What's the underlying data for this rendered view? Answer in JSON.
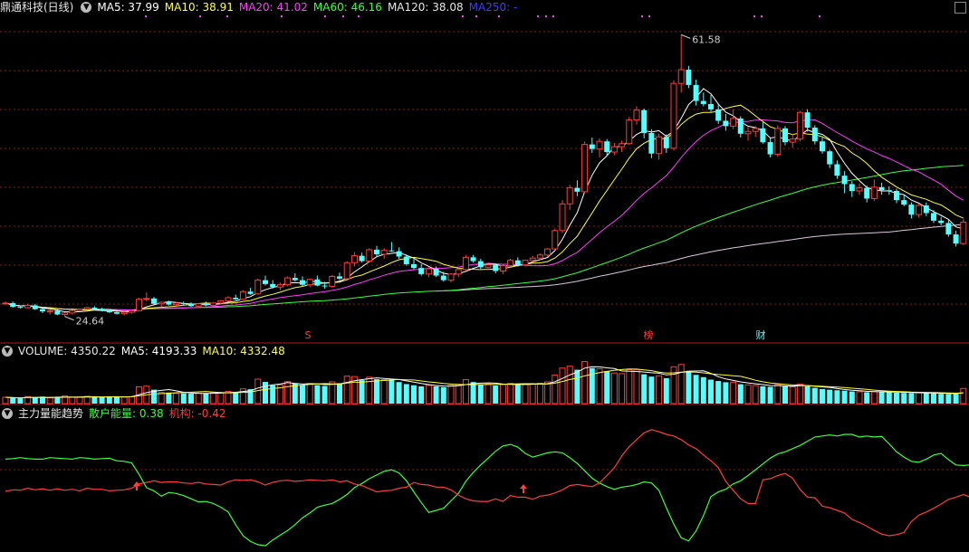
{
  "header": {
    "stock_name": "鼎通科技(日线)",
    "ma5": "MA5: 37.99",
    "ma10": "MA10: 38.91",
    "ma20": "MA20: 41.02",
    "ma60": "MA60: 46.16",
    "ma120": "MA120: 38.08",
    "ma250": "MA250: -"
  },
  "markers": {
    "s_label": "S",
    "bang_label": "榜",
    "cai_label": "财",
    "high_label": "61.58",
    "low_label": "24.64"
  },
  "volume_legend": {
    "title": "VOLUME: 4350.22",
    "ma5": "MA5: 4193.33",
    "ma10": "MA10: 4332.48"
  },
  "energy_legend": {
    "title": "主力量能趋势",
    "retail": "散户能量: 0.38",
    "inst": "机构: -0.42"
  },
  "colors": {
    "up": "#ff3c3c",
    "down": "#54ffff",
    "ma5": "#ffffff",
    "ma10": "#ffff3c",
    "ma20": "#ff3cff",
    "ma60": "#3cff3c",
    "ma120": "#ffffff",
    "grid": "#8a1a1a",
    "retail": "#3cff3c",
    "inst": "#ff3c3c"
  },
  "chart_data": [
    {
      "type": "candlestick",
      "title": "鼎通科技(日线)",
      "ylim": [
        22,
        64
      ],
      "max_price": 61.58,
      "min_price": 24.64,
      "candles": [
        [
          26.3,
          26.6,
          26.2,
          26.4
        ],
        [
          26.4,
          26.6,
          25.8,
          25.9
        ],
        [
          25.9,
          26.1,
          25.7,
          25.8
        ],
        [
          25.8,
          26.3,
          25.7,
          26.1
        ],
        [
          26.1,
          26.3,
          25.5,
          25.6
        ],
        [
          25.6,
          25.8,
          25.1,
          25.3
        ],
        [
          25.3,
          25.6,
          24.9,
          25.4
        ],
        [
          25.4,
          25.6,
          24.8,
          24.9
        ],
        [
          24.9,
          25.2,
          24.64,
          25.1
        ],
        [
          25.1,
          25.5,
          24.9,
          25.4
        ],
        [
          25.4,
          25.7,
          25.3,
          25.6
        ],
        [
          25.6,
          25.9,
          25.5,
          25.8
        ],
        [
          25.8,
          26.0,
          25.5,
          25.6
        ],
        [
          25.6,
          25.8,
          25.3,
          25.4
        ],
        [
          25.4,
          25.6,
          25.1,
          25.2
        ],
        [
          25.2,
          25.4,
          24.9,
          25.0
        ],
        [
          25.0,
          25.3,
          24.8,
          25.2
        ],
        [
          25.2,
          25.5,
          25.0,
          25.4
        ],
        [
          25.4,
          27.1,
          25.3,
          26.9
        ],
        [
          26.9,
          27.8,
          26.6,
          27.0
        ],
        [
          27.0,
          27.2,
          26.2,
          26.3
        ],
        [
          26.3,
          26.6,
          25.9,
          26.5
        ],
        [
          26.5,
          26.7,
          26.1,
          26.2
        ],
        [
          26.2,
          26.5,
          26.0,
          26.4
        ],
        [
          26.4,
          26.6,
          26.1,
          26.3
        ],
        [
          26.3,
          26.5,
          25.9,
          26.0
        ],
        [
          26.0,
          26.4,
          25.8,
          26.3
        ],
        [
          26.3,
          26.6,
          26.0,
          26.1
        ],
        [
          26.1,
          26.5,
          25.9,
          26.4
        ],
        [
          26.4,
          26.8,
          26.2,
          26.7
        ],
        [
          26.7,
          27.3,
          26.6,
          27.1
        ],
        [
          27.1,
          27.5,
          26.8,
          26.9
        ],
        [
          26.9,
          28.1,
          26.8,
          27.9
        ],
        [
          27.9,
          28.4,
          27.5,
          27.6
        ],
        [
          27.6,
          29.6,
          27.5,
          29.4
        ],
        [
          29.4,
          30.0,
          28.7,
          28.9
        ],
        [
          28.9,
          29.4,
          28.3,
          28.5
        ],
        [
          28.5,
          29.1,
          28.1,
          28.8
        ],
        [
          28.8,
          29.9,
          28.6,
          29.7
        ],
        [
          29.7,
          30.3,
          29.2,
          29.4
        ],
        [
          29.4,
          29.9,
          28.6,
          28.8
        ],
        [
          28.8,
          29.6,
          28.5,
          29.5
        ],
        [
          29.5,
          30.0,
          28.6,
          28.7
        ],
        [
          28.7,
          29.2,
          28.3,
          28.6
        ],
        [
          28.6,
          30.1,
          28.4,
          29.9
        ],
        [
          29.9,
          30.4,
          29.4,
          29.6
        ],
        [
          29.6,
          31.9,
          29.5,
          31.7
        ],
        [
          31.7,
          33.1,
          31.2,
          32.6
        ],
        [
          32.6,
          33.0,
          31.7,
          31.9
        ],
        [
          31.9,
          33.6,
          31.7,
          33.4
        ],
        [
          33.4,
          33.9,
          32.5,
          32.8
        ],
        [
          32.8,
          33.6,
          32.2,
          33.3
        ],
        [
          33.3,
          34.4,
          33.1,
          33.2
        ],
        [
          33.2,
          33.7,
          32.2,
          32.5
        ],
        [
          32.5,
          32.8,
          31.3,
          31.5
        ],
        [
          31.5,
          32.3,
          30.8,
          31.0
        ],
        [
          31.0,
          31.5,
          30.0,
          30.2
        ],
        [
          30.2,
          31.1,
          29.8,
          30.9
        ],
        [
          30.9,
          31.2,
          29.8,
          30.0
        ],
        [
          30.0,
          30.5,
          29.2,
          29.4
        ],
        [
          29.4,
          30.3,
          29.1,
          30.2
        ],
        [
          30.2,
          31.0,
          29.8,
          30.8
        ],
        [
          30.8,
          32.7,
          30.6,
          32.4
        ],
        [
          32.4,
          32.7,
          31.7,
          31.9
        ],
        [
          31.9,
          32.2,
          30.9,
          31.1
        ],
        [
          31.1,
          31.7,
          30.7,
          31.4
        ],
        [
          31.4,
          31.6,
          30.3,
          30.6
        ],
        [
          30.6,
          31.5,
          30.2,
          31.3
        ],
        [
          31.3,
          32.2,
          31.1,
          32.0
        ],
        [
          32.0,
          32.4,
          31.2,
          31.4
        ],
        [
          31.4,
          32.1,
          31.2,
          32.0
        ],
        [
          32.0,
          32.6,
          31.8,
          32.3
        ],
        [
          32.3,
          32.9,
          32.0,
          32.7
        ],
        [
          32.7,
          33.6,
          32.5,
          33.5
        ],
        [
          33.5,
          36.2,
          33.3,
          35.9
        ],
        [
          35.9,
          39.9,
          35.6,
          39.4
        ],
        [
          39.4,
          41.9,
          38.6,
          41.5
        ],
        [
          41.5,
          42.5,
          40.4,
          41.0
        ],
        [
          41.0,
          47.6,
          40.8,
          47.2
        ],
        [
          47.2,
          48.1,
          46.1,
          46.6
        ],
        [
          46.6,
          48.0,
          45.5,
          47.6
        ],
        [
          47.6,
          47.9,
          45.7,
          46.2
        ],
        [
          46.2,
          47.4,
          45.8,
          46.9
        ],
        [
          46.9,
          47.7,
          46.2,
          47.3
        ],
        [
          47.3,
          50.8,
          47.1,
          50.4
        ],
        [
          50.4,
          52.2,
          49.8,
          51.7
        ],
        [
          51.7,
          51.9,
          48.0,
          48.7
        ],
        [
          48.7,
          49.2,
          45.4,
          46.0
        ],
        [
          46.0,
          48.6,
          45.2,
          48.2
        ],
        [
          48.2,
          48.5,
          46.1,
          46.7
        ],
        [
          46.7,
          55.6,
          46.4,
          55.2
        ],
        [
          55.2,
          61.58,
          54.0,
          57.0
        ],
        [
          57.0,
          57.5,
          54.6,
          55.0
        ],
        [
          55.0,
          55.7,
          52.3,
          52.9
        ],
        [
          52.9,
          54.0,
          52.2,
          52.5
        ],
        [
          52.5,
          53.7,
          51.5,
          51.8
        ],
        [
          51.8,
          52.6,
          49.9,
          50.3
        ],
        [
          50.3,
          51.2,
          49.0,
          49.6
        ],
        [
          49.6,
          51.8,
          49.2,
          50.6
        ],
        [
          50.6,
          50.9,
          48.1,
          48.6
        ],
        [
          48.6,
          49.5,
          47.7,
          48.9
        ],
        [
          48.9,
          49.6,
          48.2,
          49.3
        ],
        [
          49.3,
          50.1,
          47.3,
          47.5
        ],
        [
          47.5,
          48.0,
          45.5,
          45.9
        ],
        [
          45.9,
          49.7,
          45.6,
          49.3
        ],
        [
          49.3,
          49.6,
          47.1,
          47.5
        ],
        [
          47.5,
          48.6,
          46.8,
          47.9
        ],
        [
          47.9,
          51.6,
          47.6,
          51.4
        ],
        [
          51.4,
          51.8,
          48.9,
          49.4
        ],
        [
          49.4,
          49.7,
          47.2,
          47.6
        ],
        [
          47.6,
          48.1,
          46.0,
          46.3
        ],
        [
          46.3,
          46.5,
          44.1,
          44.6
        ],
        [
          44.6,
          45.1,
          42.7,
          43.1
        ],
        [
          43.1,
          43.7,
          40.8,
          42.0
        ],
        [
          42.0,
          42.4,
          40.3,
          41.1
        ],
        [
          41.1,
          42.1,
          40.6,
          41.5
        ],
        [
          41.5,
          41.8,
          39.6,
          40.1
        ],
        [
          40.1,
          42.6,
          39.8,
          41.6
        ],
        [
          41.6,
          42.2,
          40.6,
          41.2
        ],
        [
          41.2,
          41.7,
          40.6,
          41.1
        ],
        [
          41.1,
          41.4,
          39.5,
          39.9
        ],
        [
          39.9,
          40.6,
          39.1,
          39.3
        ],
        [
          39.3,
          39.6,
          37.5,
          38.0
        ],
        [
          38.0,
          39.4,
          37.6,
          39.2
        ],
        [
          39.2,
          39.6,
          37.8,
          38.2
        ],
        [
          38.2,
          38.6,
          36.9,
          37.2
        ],
        [
          37.2,
          37.7,
          36.6,
          36.9
        ],
        [
          36.9,
          37.4,
          35.1,
          35.4
        ],
        [
          35.4,
          35.9,
          33.8,
          34.2
        ],
        [
          34.2,
          37.4,
          34.0,
          37.0
        ]
      ],
      "series": [
        {
          "name": "MA5",
          "values": [
            37.99
          ]
        },
        {
          "name": "MA10",
          "values": [
            38.91
          ]
        },
        {
          "name": "MA20",
          "values": [
            41.02
          ]
        },
        {
          "name": "MA60",
          "values": [
            46.16
          ]
        },
        {
          "name": "MA120",
          "values": [
            38.08
          ]
        }
      ]
    },
    {
      "type": "bar",
      "title": "VOLUME",
      "ylim": [
        0,
        13000
      ],
      "values": [
        1813,
        1642,
        1497,
        2007,
        1760,
        2008,
        1632,
        1853,
        2224,
        1811,
        1869,
        2084,
        1864,
        1790,
        2104,
        2058,
        1863,
        2013,
        4813,
        5007,
        3998,
        3202,
        3167,
        2969,
        2958,
        2851,
        2934,
        2963,
        3084,
        3243,
        3530,
        3386,
        4240,
        4134,
        7018,
        6226,
        5251,
        5398,
        6303,
        5876,
        5256,
        5741,
        5302,
        5073,
        6245,
        5846,
        7895,
        7758,
        6727,
        7581,
        7002,
        6898,
        6962,
        6186,
        5607,
        5271,
        4955,
        5256,
        4957,
        4721,
        5219,
        5553,
        6898,
        6188,
        5576,
        5588,
        5192,
        5484,
        5793,
        5428,
        5505,
        5600,
        5853,
        6237,
        8210,
        10210,
        10733,
        9733,
        12067,
        10216,
        10002,
        9294,
        8792,
        8603,
        9738,
        9781,
        8421,
        7757,
        7989,
        7311,
        10593,
        11223,
        9412,
        8251,
        7603,
        6888,
        6486,
        6138,
        6161,
        5571,
        5382,
        5193,
        4988,
        4826,
        5513,
        4940,
        4785,
        5614,
        4988,
        4526,
        4190,
        3995,
        3839,
        3711,
        3485,
        3400,
        3270,
        3445,
        3373,
        3275,
        3134,
        3060,
        2993,
        3146,
        3033,
        2896,
        2805,
        2740,
        2697,
        4350
      ],
      "series": [
        {
          "name": "MA5",
          "values": [
            4193.33
          ]
        },
        {
          "name": "MA10",
          "values": [
            4332.48
          ]
        }
      ]
    },
    {
      "type": "line",
      "title": "主力量能趋势",
      "ylim": [
        -1.2,
        1.2
      ],
      "series": [
        {
          "name": "散户能量",
          "values": [
            0.49,
            0.5,
            0.52,
            0.5,
            0.49,
            0.49,
            0.52,
            0.51,
            0.5,
            0.49,
            0.52,
            0.51,
            0.49,
            0.5,
            0.51,
            0.46,
            0.45,
            0.42,
            0.2,
            -0.05,
            -0.11,
            -0.21,
            -0.14,
            -0.16,
            -0.2,
            -0.26,
            -0.32,
            -0.31,
            -0.35,
            -0.42,
            -0.51,
            -0.75,
            -0.96,
            -1.07,
            -1.13,
            -1.15,
            -1.04,
            -0.95,
            -0.86,
            -0.75,
            -0.62,
            -0.53,
            -0.42,
            -0.38,
            -0.35,
            -0.27,
            -0.18,
            -0.05,
            0.03,
            0.12,
            0.19,
            0.26,
            0.29,
            0.23,
            0.08,
            -0.13,
            -0.33,
            -0.52,
            -0.48,
            -0.44,
            -0.3,
            -0.16,
            0.07,
            0.24,
            0.38,
            0.51,
            0.64,
            0.74,
            0.77,
            0.72,
            0.6,
            0.53,
            0.57,
            0.61,
            0.63,
            0.61,
            0.52,
            0.41,
            0.27,
            0.13,
            0.04,
            -0.03,
            -0.08,
            -0.04,
            -0.02,
            0.01,
            0.06,
            0.04,
            -0.1,
            -0.43,
            -0.74,
            -1.0,
            -1.06,
            -0.87,
            -0.58,
            -0.22,
            -0.13,
            -0.08,
            0.02,
            0.08,
            0.18,
            0.29,
            0.4,
            0.51,
            0.59,
            0.63,
            0.69,
            0.75,
            0.83,
            0.91,
            0.93,
            0.95,
            0.93,
            0.96,
            0.96,
            0.91,
            0.93,
            0.91,
            0.92,
            0.78,
            0.63,
            0.53,
            0.45,
            0.43,
            0.49,
            0.57,
            0.6,
            0.48,
            0.38,
            0.37,
            0.38,
            0.38,
            0.38
          ]
        },
        {
          "name": "机构",
          "values": [
            -0.12,
            -0.09,
            -0.1,
            -0.06,
            -0.09,
            -0.07,
            -0.1,
            -0.07,
            -0.1,
            -0.08,
            -0.11,
            -0.06,
            -0.08,
            -0.08,
            -0.11,
            -0.1,
            -0.09,
            -0.06,
            0.02,
            0.05,
            0.08,
            0.05,
            0.06,
            0.06,
            0.04,
            0.03,
            0.05,
            0.02,
            0.01,
            0.0,
            0.06,
            0.1,
            0.09,
            0.1,
            0.06,
            0.0,
            0.05,
            0.08,
            0.09,
            0.07,
            0.08,
            0.1,
            0.09,
            0.08,
            0.1,
            0.06,
            0.08,
            0.02,
            -0.01,
            -0.07,
            -0.13,
            -0.11,
            -0.1,
            -0.06,
            -0.04,
            0.05,
            0.01,
            0.0,
            -0.04,
            -0.04,
            -0.09,
            -0.19,
            -0.26,
            -0.3,
            -0.31,
            -0.31,
            -0.26,
            -0.31,
            -0.2,
            -0.23,
            -0.23,
            -0.27,
            -0.21,
            -0.19,
            -0.15,
            -0.09,
            -0.01,
            0.01,
            -0.01,
            -0.03,
            0.04,
            0.18,
            0.33,
            0.55,
            0.73,
            0.86,
            0.99,
            1.05,
            1.01,
            0.96,
            0.93,
            0.86,
            0.76,
            0.69,
            0.57,
            0.46,
            0.33,
            0.07,
            -0.1,
            -0.26,
            -0.35,
            -0.35,
            0.1,
            0.12,
            0.18,
            0.22,
            0.13,
            -0.08,
            -0.23,
            -0.24,
            -0.4,
            -0.43,
            -0.48,
            -0.53,
            -0.65,
            -0.71,
            -0.78,
            -0.86,
            -0.93,
            -0.96,
            -0.94,
            -0.9,
            -0.69,
            -0.57,
            -0.51,
            -0.44,
            -0.36,
            -0.27,
            -0.23,
            -0.18,
            -0.23,
            -0.23,
            -0.2,
            -0.17,
            -0.21,
            -0.23,
            -0.42
          ]
        }
      ]
    }
  ]
}
